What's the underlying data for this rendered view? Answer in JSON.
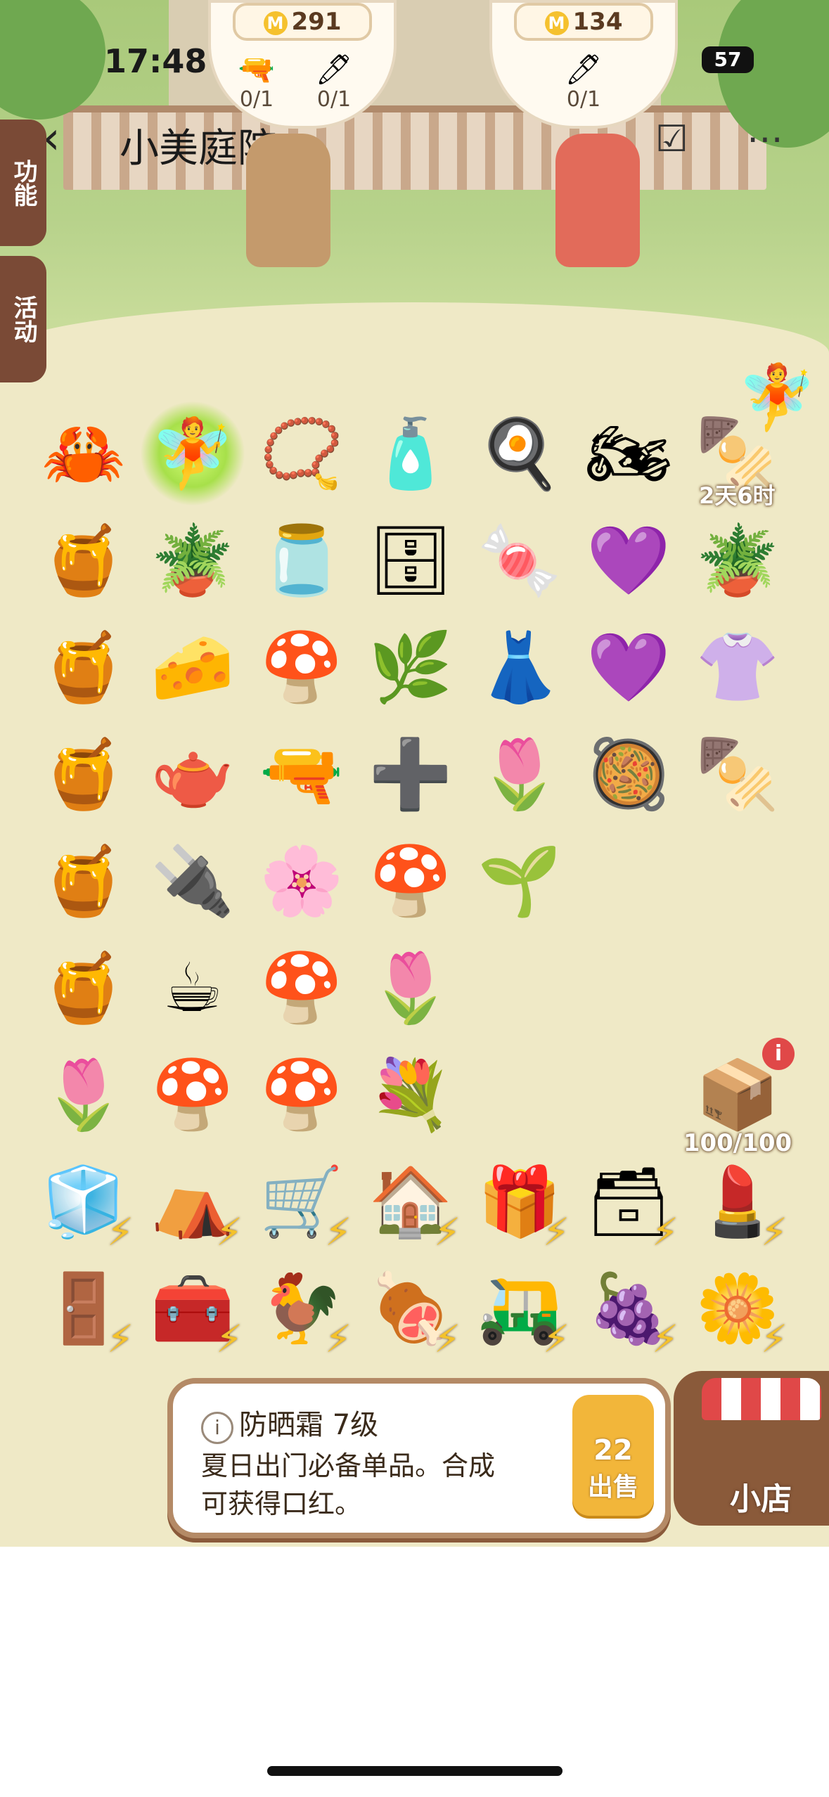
{
  "status_bar": {
    "time": "17:48",
    "battery": "57"
  },
  "nav": {
    "back_icon": "chevron-left-icon",
    "title": "小美庭院",
    "bookmark_icon": "bookmark-check-icon",
    "more_icon": "more-icon"
  },
  "npc_left": {
    "coins": "291",
    "requests": [
      {
        "icon": "water-gun-icon",
        "progress": "0/1"
      },
      {
        "icon": "pen-icon",
        "progress": "0/1"
      }
    ]
  },
  "npc_right": {
    "coins": "134",
    "requests": [
      {
        "icon": "pen-icon",
        "progress": "0/1"
      }
    ]
  },
  "side_tabs": {
    "function": "功能",
    "activity": "活动"
  },
  "board": {
    "timer_label": "2天6时",
    "chest_count": "100/100",
    "items": [
      {
        "name": "crab-icon",
        "glyph": "🦀"
      },
      {
        "name": "sprite-egg-icon",
        "glyph": "🧚",
        "glow": true
      },
      {
        "name": "necklace-icon",
        "glyph": "📿"
      },
      {
        "name": "sunscreen-bottle-icon",
        "glyph": "🧴"
      },
      {
        "name": "stove-icon",
        "glyph": "🍳"
      },
      {
        "name": "motorcycle-icon",
        "glyph": "🏍"
      },
      {
        "name": "bbq-grill-icon",
        "glyph": "🍢"
      },
      {
        "name": "honey-pot-icon",
        "glyph": "🍯"
      },
      {
        "name": "potted-plant-icon",
        "glyph": "🪴"
      },
      {
        "name": "cream-jar-icon",
        "glyph": "🫙"
      },
      {
        "name": "pink-cabinet-icon",
        "glyph": "🗄"
      },
      {
        "name": "candy-icon",
        "glyph": "🍬"
      },
      {
        "name": "bracelet-icon",
        "glyph": "💜"
      },
      {
        "name": "potted-plant-icon",
        "glyph": "🪴"
      },
      {
        "name": "honey-pot-icon",
        "glyph": "🍯"
      },
      {
        "name": "cheese-tile-icon",
        "glyph": "🧀"
      },
      {
        "name": "purple-mushroom-icon",
        "glyph": "🍄"
      },
      {
        "name": "fern-plant-icon",
        "glyph": "🌿"
      },
      {
        "name": "blue-skirt-icon",
        "glyph": "👗"
      },
      {
        "name": "bracelet-icon",
        "glyph": "💜"
      },
      {
        "name": "clothes-rack-icon",
        "glyph": "👚"
      },
      {
        "name": "honey-pot-icon",
        "glyph": "🍯"
      },
      {
        "name": "kettle-icon",
        "glyph": "🫖"
      },
      {
        "name": "water-gun-icon",
        "glyph": "🔫"
      },
      {
        "name": "plus-five-orb-icon",
        "glyph": "➕"
      },
      {
        "name": "tulip-icon",
        "glyph": "🌷"
      },
      {
        "name": "saucepan-icon",
        "glyph": "🥘"
      },
      {
        "name": "bbq-grill-icon",
        "glyph": "🍢"
      },
      {
        "name": "honey-pot-icon",
        "glyph": "🍯"
      },
      {
        "name": "power-strip-icon",
        "glyph": "🔌"
      },
      {
        "name": "flower-pot-icon",
        "glyph": "🌸"
      },
      {
        "name": "green-mushroom-icon",
        "glyph": "🍄"
      },
      {
        "name": "small-plant-icon",
        "glyph": "🌱"
      },
      {
        "name": "honey-pot-icon",
        "glyph": "🍯"
      },
      {
        "name": "coffee-cup-icon",
        "glyph": "☕"
      },
      {
        "name": "blue-mushroom-icon",
        "glyph": "🍄"
      },
      {
        "name": "tulip-icon",
        "glyph": "🌷"
      },
      {
        "name": "tulip-icon",
        "glyph": "🌷"
      },
      {
        "name": "red-mushroom-icon",
        "glyph": "🍄"
      },
      {
        "name": "red-mushroom-icon",
        "glyph": "🍄"
      },
      {
        "name": "bouquet-icon",
        "glyph": "💐"
      },
      {
        "name": "fridge-icon",
        "glyph": "🧊",
        "bolt": true
      },
      {
        "name": "purple-tent-icon",
        "glyph": "⛺",
        "bolt": true
      },
      {
        "name": "shopping-cart-icon",
        "glyph": "🛒",
        "bolt": true
      },
      {
        "name": "greenhouse-icon",
        "glyph": "🏠",
        "bolt": true
      },
      {
        "name": "display-case-icon",
        "glyph": "🎁",
        "bolt": true
      },
      {
        "name": "safe-box-icon",
        "glyph": "🗃",
        "bolt": true
      },
      {
        "name": "makeup-box-icon",
        "glyph": "💄",
        "bolt": true
      },
      {
        "name": "wooden-cabinet-icon",
        "glyph": "🚪",
        "bolt": true
      },
      {
        "name": "treasure-chest-icon",
        "glyph": "🧰",
        "bolt": true
      },
      {
        "name": "chicken-icon",
        "glyph": "🐓",
        "bolt": true
      },
      {
        "name": "grill-cart-icon",
        "glyph": "🍖",
        "bolt": true
      },
      {
        "name": "cart-icon",
        "glyph": "🛺",
        "bolt": true
      },
      {
        "name": "fruit-stand-icon",
        "glyph": "🍇",
        "bolt": true
      },
      {
        "name": "flower-planter-icon",
        "glyph": "🌼",
        "bolt": true
      }
    ]
  },
  "info_panel": {
    "item_name": "防晒霜 7级",
    "description": "夏日出门必备单品。合成可获得口红。",
    "sell_price": "22",
    "sell_label": "出售"
  },
  "shop": {
    "label": "小店"
  },
  "colors": {
    "board_bg": "#efe9c6",
    "panel_border": "#b48a66",
    "sell_btn": "#f2b63a",
    "tab_bg": "#7a4a36"
  }
}
